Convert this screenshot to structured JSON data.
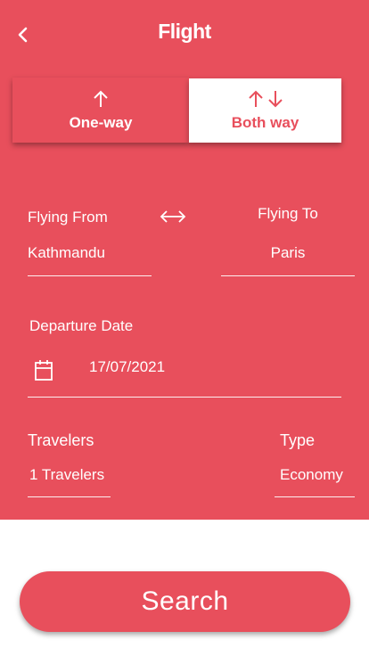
{
  "header": {
    "title": "Flight",
    "back_icon": "chevron-left-icon"
  },
  "trip_type": {
    "one_way": {
      "label": "One-way",
      "icon": "arrow-up-icon",
      "selected": false
    },
    "both_way": {
      "label": "Both way",
      "icon": "arrows-up-down-icon",
      "selected": true
    }
  },
  "route": {
    "from_label": "Flying From",
    "from_value": "Kathmandu",
    "to_label": "Flying To",
    "to_value": "Paris",
    "swap_icon": "swap-arrows-icon"
  },
  "departure": {
    "label": "Departure Date",
    "value": "17/07/2021",
    "icon": "calendar-icon"
  },
  "travelers": {
    "label": "Travelers",
    "value": "1 Travelers"
  },
  "type": {
    "label": "Type",
    "value": "Economy"
  },
  "search": {
    "label": "Search"
  },
  "colors": {
    "accent": "#e84f5c",
    "surface": "#ffffff"
  }
}
